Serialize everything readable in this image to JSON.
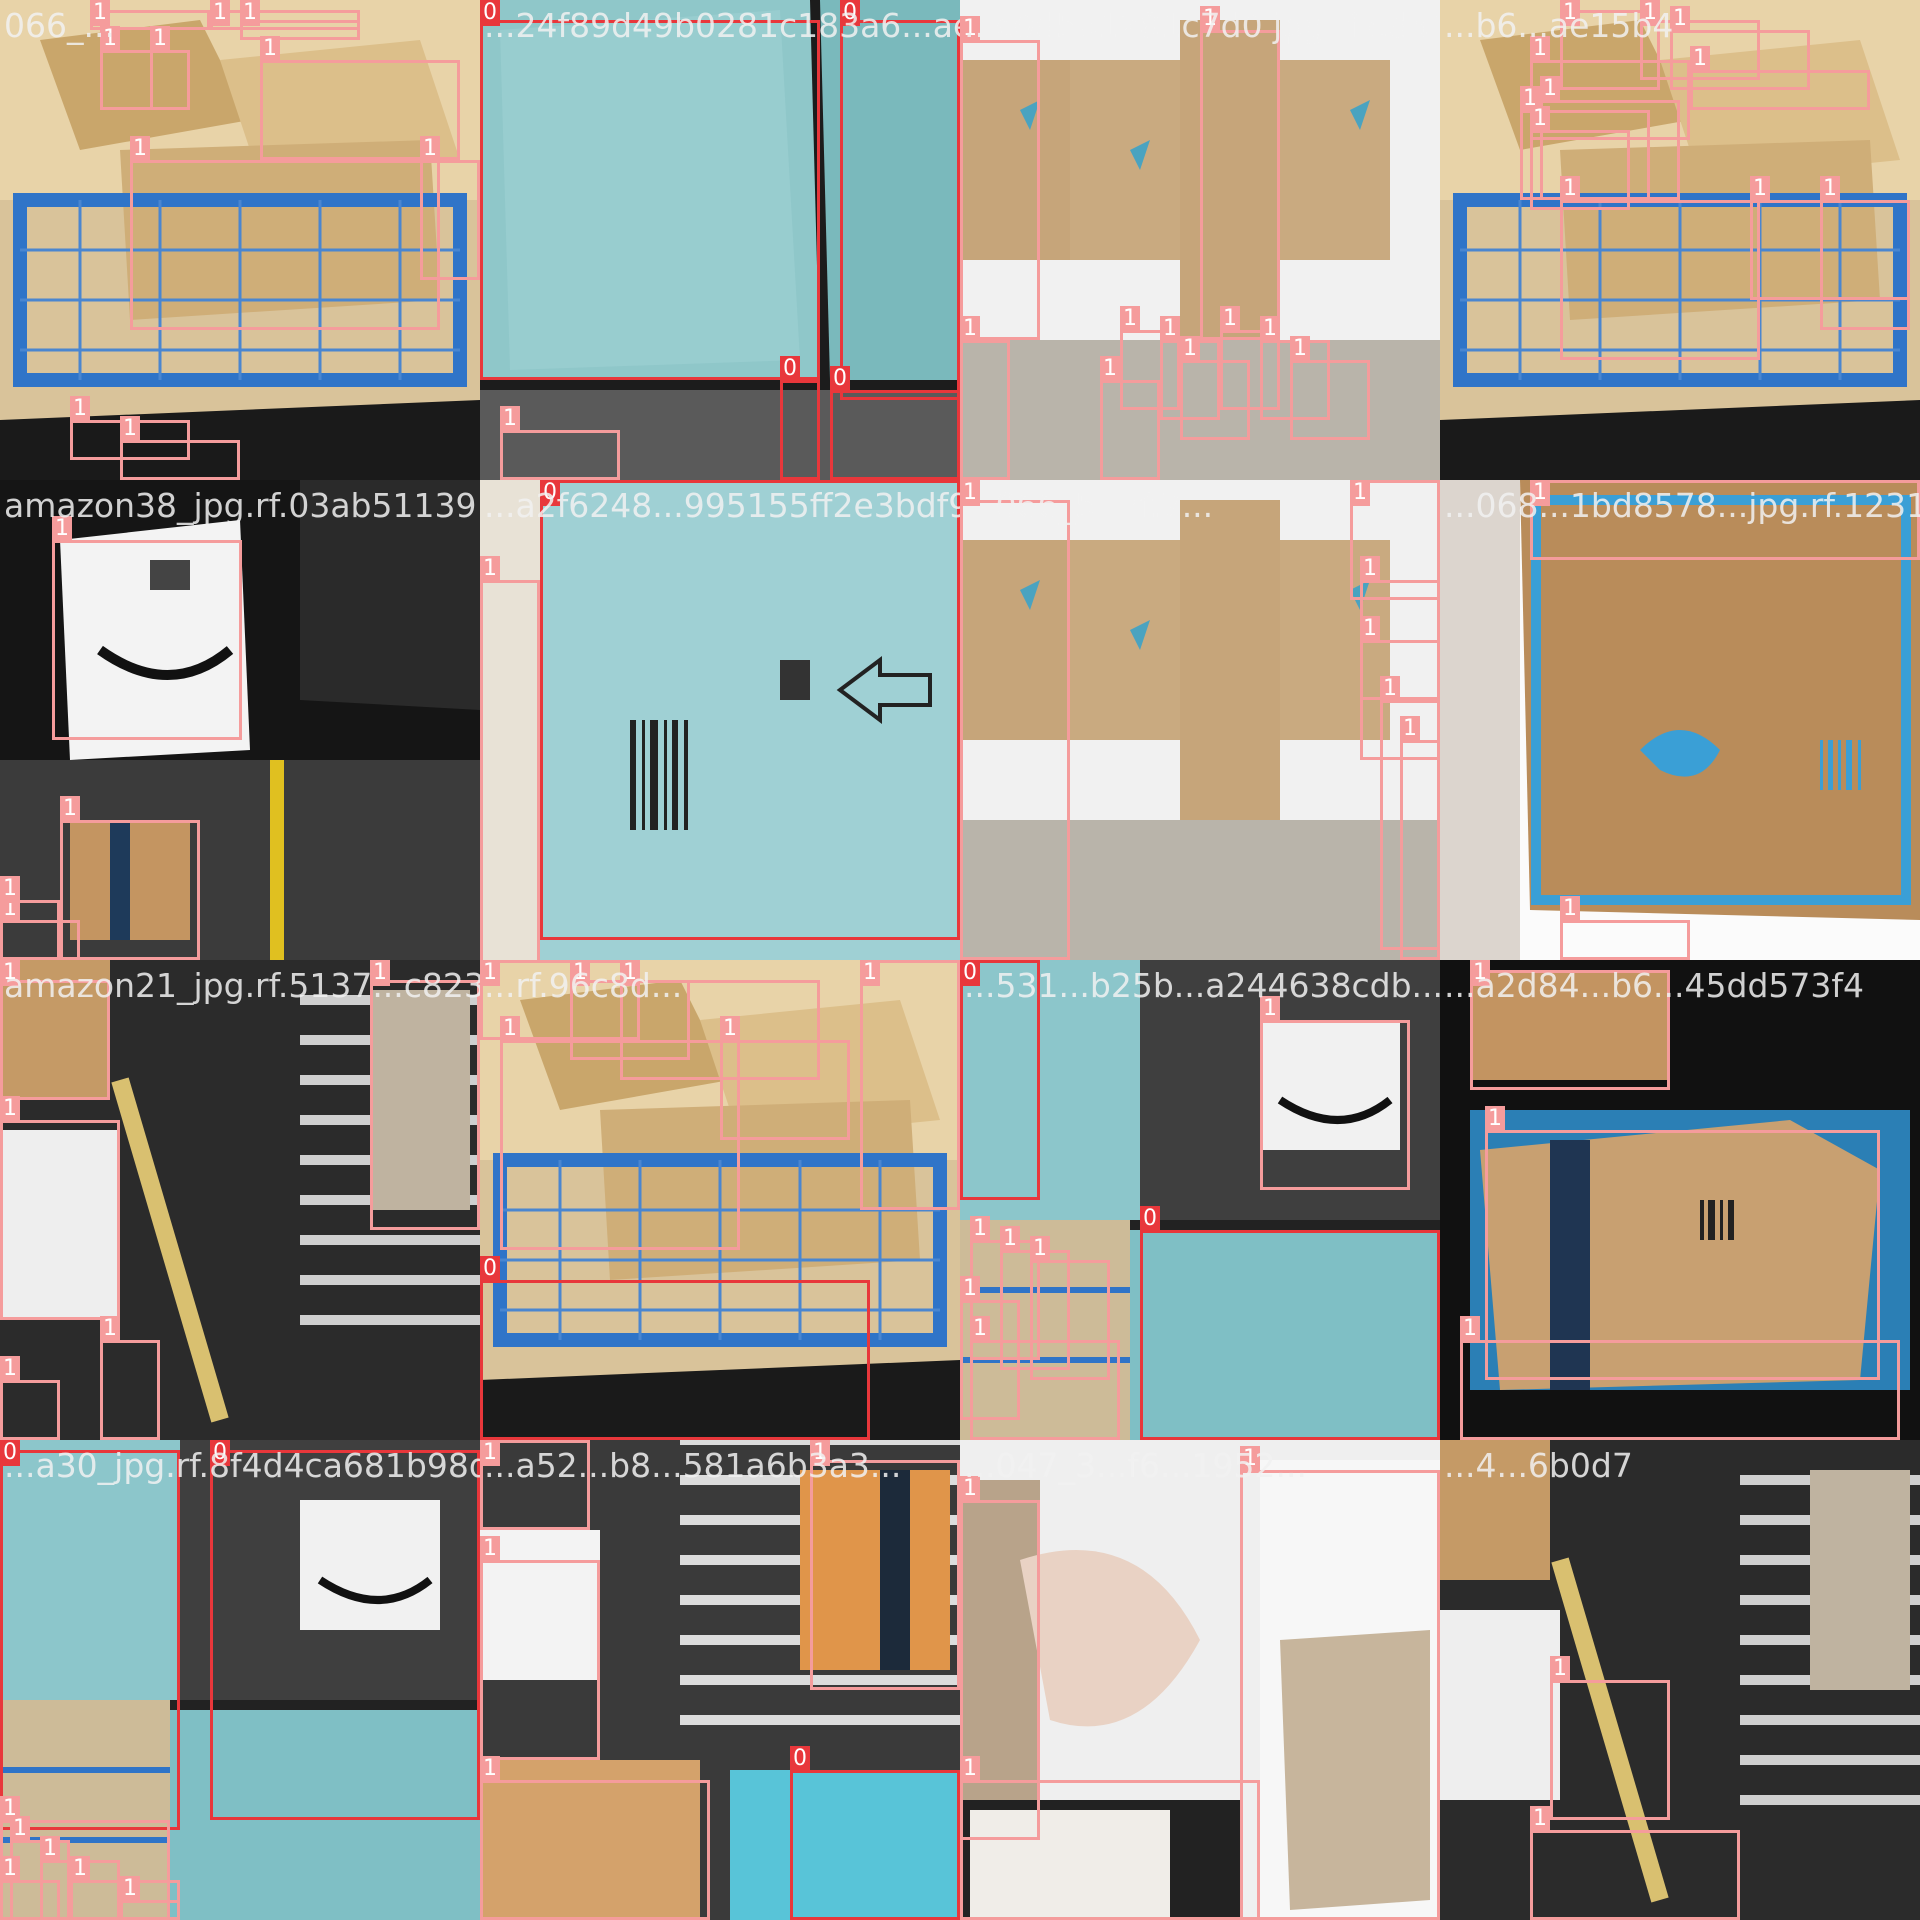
{
  "mosaic": {
    "colors": {
      "class_0": "#e8373b",
      "class_1": "#f59c9c",
      "label_text": "#ffffff"
    },
    "tiles": [
      {
        "filename": "066_...",
        "scene": "blue-cart-flipkart",
        "class_labels": [
          "1",
          "1",
          "1",
          "1",
          "1",
          "1",
          "1",
          "1",
          "1",
          "1"
        ]
      },
      {
        "filename": "...24f89d49b0281c183a6...ae6...",
        "scene": "teal-mailer",
        "class_labels": [
          "0",
          "0",
          "0",
          "1",
          "0"
        ]
      },
      {
        "filename": "...c0d5b1281c7d0 jpg.rf.ed5149...",
        "scene": "flipkart-box-flat",
        "class_labels": [
          "1",
          "1",
          "1",
          "1",
          "1",
          "1",
          "1",
          "1",
          "1",
          "1"
        ]
      },
      {
        "filename": "...b6...ae15b4",
        "scene": "blue-cart-flipkart",
        "class_labels": [
          "1",
          "1",
          "1",
          "1",
          "1",
          "1",
          "1",
          "1",
          "1",
          "1",
          "1"
        ]
      },
      {
        "filename": "amazon38_jpg.rf.03ab51139...",
        "scene": "amazon-white-bag",
        "class_labels": [
          "1",
          "1",
          "1",
          "1"
        ]
      },
      {
        "filename": "...a2f6248...995155ff2e3bdf9...",
        "scene": "teal-mailer-barcode",
        "class_labels": [
          "1",
          "0"
        ]
      },
      {
        "filename": "...066_5...rf.7...",
        "scene": "flipkart-box-flat",
        "class_labels": [
          "1",
          "1",
          "1",
          "1",
          "1",
          "1"
        ]
      },
      {
        "filename": "...068...1bd8578...jpg.rf.1231b...",
        "scene": "flipkart-box-closeup",
        "class_labels": [
          "1",
          "1"
        ]
      },
      {
        "filename": "amazon21_jpg.rf.5137...c823...",
        "scene": "amazon-conveyor",
        "class_labels": [
          "1",
          "1",
          "1",
          "1",
          "1"
        ]
      },
      {
        "filename": "...rf.96c8d...",
        "scene": "blue-cart-flipkart",
        "class_labels": [
          "1",
          "1",
          "1",
          "1",
          "1",
          "1",
          "0"
        ]
      },
      {
        "filename": "...531...b25b...a244638cdb...",
        "scene": "teal-mailer-and-cart",
        "class_labels": [
          "0",
          "1",
          "1",
          "1",
          "1",
          "1",
          "1",
          "0"
        ]
      },
      {
        "filename": "...a2d84...b6...45dd573f4",
        "scene": "amazon-box-prime",
        "class_labels": [
          "1",
          "1",
          "1"
        ]
      },
      {
        "filename": "...a30_jpg.rf.8f4d4ca681b98d2...",
        "scene": "teal-mailer-and-cart",
        "class_labels": [
          "0",
          "0",
          "1",
          "1",
          "1",
          "1",
          "1",
          "1"
        ]
      },
      {
        "filename": "...a52...b8...581a6b3a3...",
        "scene": "amazon-prime-box",
        "class_labels": [
          "1",
          "1",
          "1",
          "1",
          "0"
        ]
      },
      {
        "filename": "...047_3...f6...1952...",
        "scene": "hands-box",
        "class_labels": [
          "1",
          "1",
          "1"
        ]
      },
      {
        "filename": "...4...6b0d7",
        "scene": "amazon-conveyor",
        "class_labels": [
          "1",
          "1"
        ]
      }
    ]
  }
}
